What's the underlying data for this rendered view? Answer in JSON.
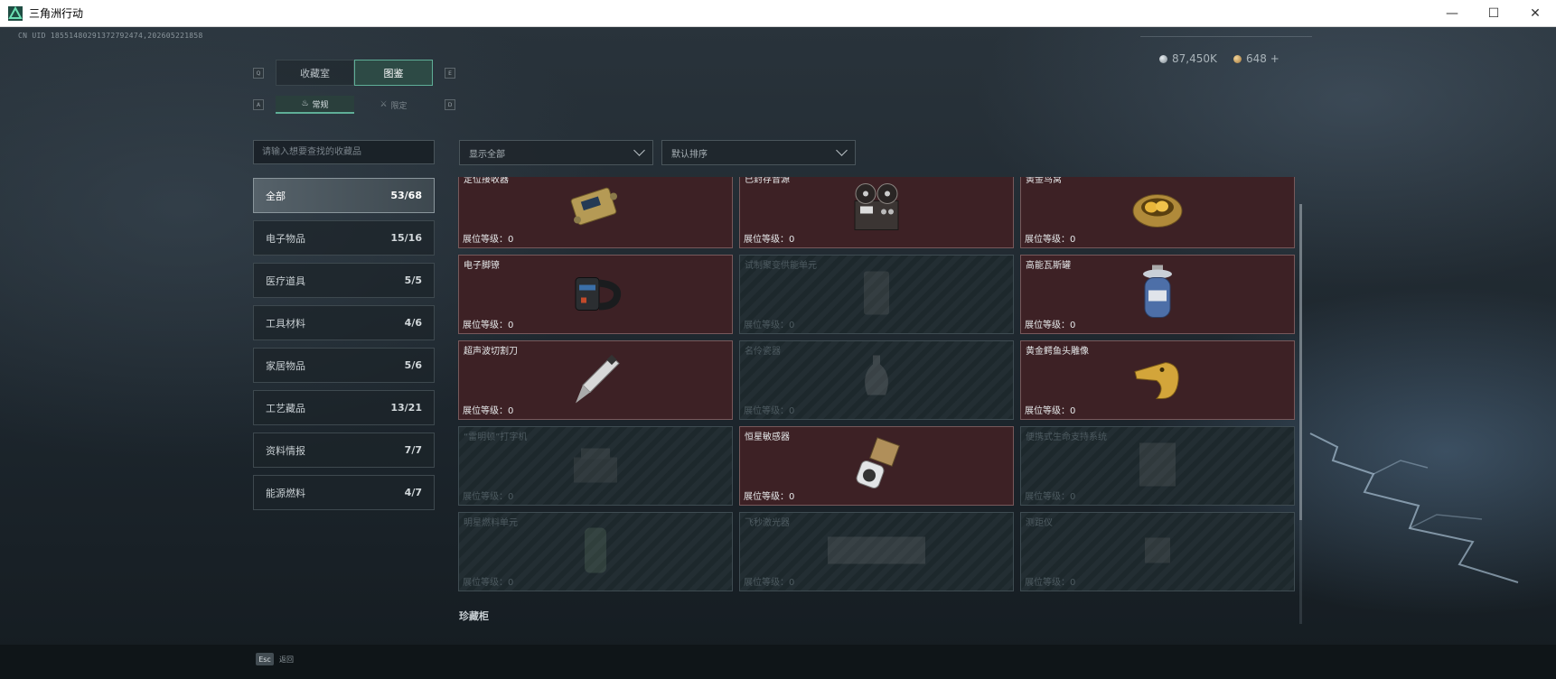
{
  "window": {
    "title": "三角洲行动",
    "minimize": "—",
    "maximize": "☐",
    "close": "✕"
  },
  "uid_text": "CN UID 18551480291372792474,202605221858",
  "currency": {
    "silver": "87,450K",
    "gold": "648 +"
  },
  "main_tabs": [
    {
      "label": "收藏室",
      "active": false
    },
    {
      "label": "图鉴",
      "active": true
    }
  ],
  "main_tabs_keys": {
    "left": "Q",
    "right": "E"
  },
  "sub_tabs": [
    {
      "label": "常规",
      "active": true
    },
    {
      "label": "限定",
      "active": false
    }
  ],
  "sub_tabs_keys": {
    "left": "A",
    "right": "D"
  },
  "search": {
    "placeholder": "请输入想要查找的收藏品"
  },
  "filters": {
    "show": "显示全部",
    "sort": "默认排序"
  },
  "categories": [
    {
      "label": "全部",
      "count": "53/68",
      "active": true
    },
    {
      "label": "电子物品",
      "count": "15/16"
    },
    {
      "label": "医疗道具",
      "count": "5/5"
    },
    {
      "label": "工具材料",
      "count": "4/6"
    },
    {
      "label": "家居物品",
      "count": "5/6"
    },
    {
      "label": "工艺藏品",
      "count": "13/21"
    },
    {
      "label": "资料情报",
      "count": "7/7"
    },
    {
      "label": "能源燃料",
      "count": "4/7"
    }
  ],
  "level_label": "展位等级：0",
  "items": [
    {
      "name": "定位接收器",
      "owned": true,
      "icon": "receiver-icon"
    },
    {
      "name": "已封存音源",
      "owned": true,
      "icon": "reel-recorder-icon"
    },
    {
      "name": "黄金鸟窝",
      "owned": true,
      "icon": "golden-nest-icon"
    },
    {
      "name": "电子脚镣",
      "owned": true,
      "icon": "ankle-monitor-icon"
    },
    {
      "name": "试制聚变供能单元",
      "owned": false,
      "icon": "fusion-cell-icon"
    },
    {
      "name": "高能瓦斯罐",
      "owned": true,
      "icon": "gas-canister-icon"
    },
    {
      "name": "超声波切割刀",
      "owned": true,
      "icon": "ultrasonic-knife-icon"
    },
    {
      "name": "名伶瓷器",
      "owned": false,
      "icon": "porcelain-vase-icon"
    },
    {
      "name": "黄金鳄鱼头雕像",
      "owned": true,
      "icon": "gold-crocodile-icon"
    },
    {
      "name": "“雷明顿”打字机",
      "owned": false,
      "icon": "typewriter-icon"
    },
    {
      "name": "恒星敏感器",
      "owned": true,
      "icon": "star-sensor-icon"
    },
    {
      "name": "便携式生命支持系统",
      "owned": false,
      "icon": "life-support-icon"
    },
    {
      "name": "明星燃料单元",
      "owned": false,
      "icon": "fuel-cell-icon"
    },
    {
      "name": "飞秒激光器",
      "owned": false,
      "icon": "laser-icon"
    },
    {
      "name": "测距仪",
      "owned": false,
      "icon": "rangefinder-icon"
    }
  ],
  "section_title": "珍藏柜",
  "esc": {
    "key": "Esc",
    "label": "返回"
  },
  "colors": {
    "accent": "#5fae97",
    "owned_card": "#3d2125",
    "locked_card": "#1f2a2f"
  }
}
